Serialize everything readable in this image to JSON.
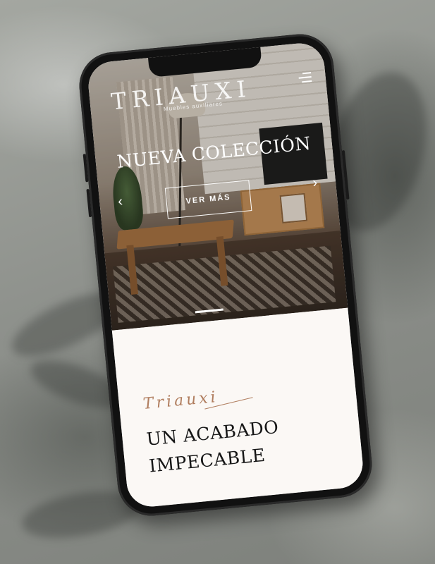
{
  "brand": {
    "logo_text": "TRIAUXI",
    "tagline": "Muebles auxiliares"
  },
  "header": {
    "menu_icon": "hamburger-menu-icon"
  },
  "hero": {
    "title": "NUEVA COLECCIÓN",
    "cta_label": "VER MÁS",
    "prev_arrow": "‹",
    "next_arrow": "›"
  },
  "intro": {
    "script_label": "Triauxi",
    "headline_line1": "UN ACABADO",
    "headline_line2": "IMPECABLE"
  },
  "colors": {
    "accent": "#b07d5e",
    "text": "#161616",
    "page_bg": "#fbf8f5"
  }
}
